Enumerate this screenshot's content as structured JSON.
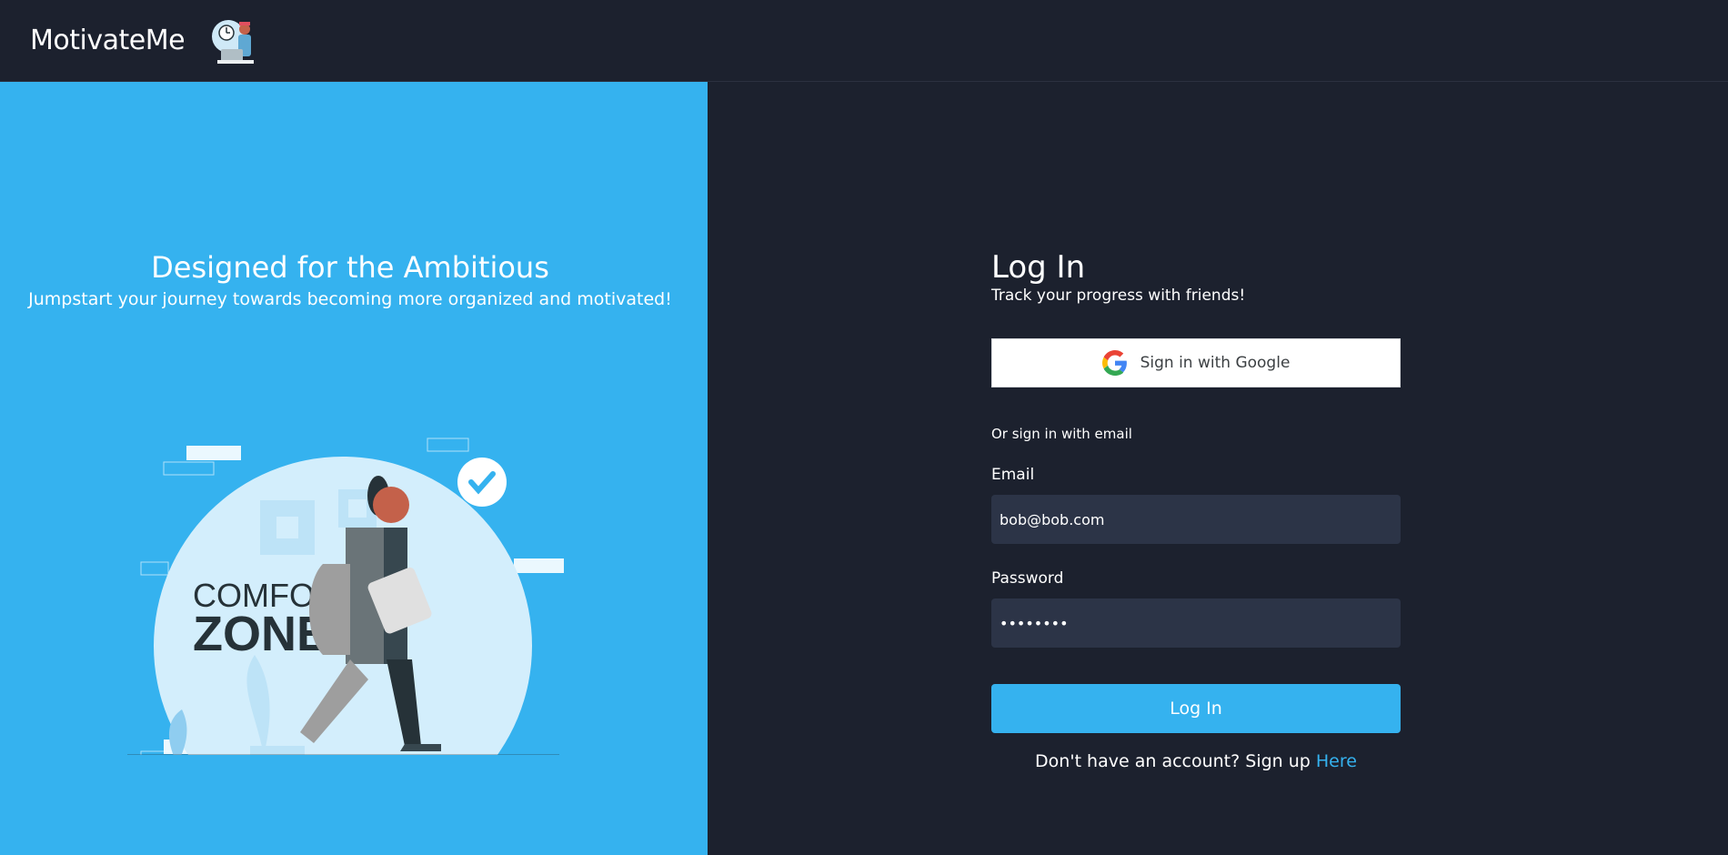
{
  "navbar": {
    "brand": "MotivateMe",
    "logo_icon": "person-at-laptop-logo-icon"
  },
  "hero": {
    "title": "Designed for the Ambitious",
    "subtitle": "Jumpstart your journey towards becoming more organized and motivated!",
    "illustration_text_1": "COMFORT",
    "illustration_text_2": "ZONE"
  },
  "login": {
    "title": "Log In",
    "subtitle": "Track your progress with friends!",
    "google_label": "Sign in with Google",
    "or_text": "Or sign in with email",
    "email_label": "Email",
    "email_value": "bob@bob.com",
    "password_label": "Password",
    "password_value": "••••••••",
    "submit_label": "Log In",
    "signup_text": "Don't have an account? Sign up ",
    "signup_link": "Here"
  },
  "colors": {
    "accent": "#35b2ef",
    "background": "#1c212e",
    "input": "#2c3447"
  }
}
